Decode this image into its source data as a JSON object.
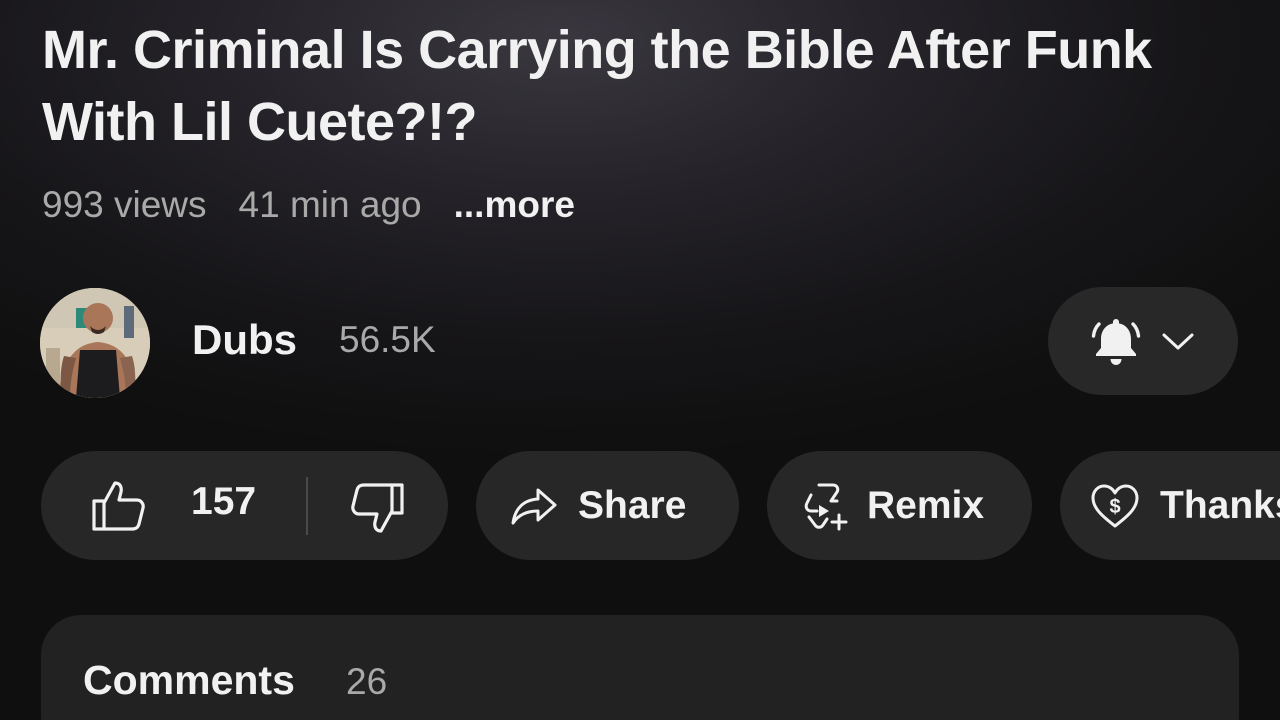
{
  "video": {
    "title": "Mr. Criminal Is Carrying the Bible After Funk With Lil Cuete?!?",
    "views": "993 views",
    "time_ago": "41 min ago",
    "more_label": "...more"
  },
  "channel": {
    "name": "Dubs",
    "subscribers": "56.5K",
    "avatar_icon": "channel-avatar",
    "bell_icon": "bell-ringing-icon",
    "chevron_icon": "chevron-down-icon"
  },
  "actions": {
    "like_count": "157",
    "like_icon": "thumbs-up-icon",
    "dislike_icon": "thumbs-down-icon",
    "share_label": "Share",
    "share_icon": "share-arrow-icon",
    "remix_label": "Remix",
    "remix_icon": "remix-icon",
    "thanks_label": "Thanks",
    "thanks_icon": "heart-dollar-icon"
  },
  "comments": {
    "title": "Comments",
    "count": "26"
  },
  "colors": {
    "background": "#0f0f0f",
    "pill": "#272727",
    "text_primary": "#f1f1f1",
    "text_secondary": "#a9a9a9"
  }
}
